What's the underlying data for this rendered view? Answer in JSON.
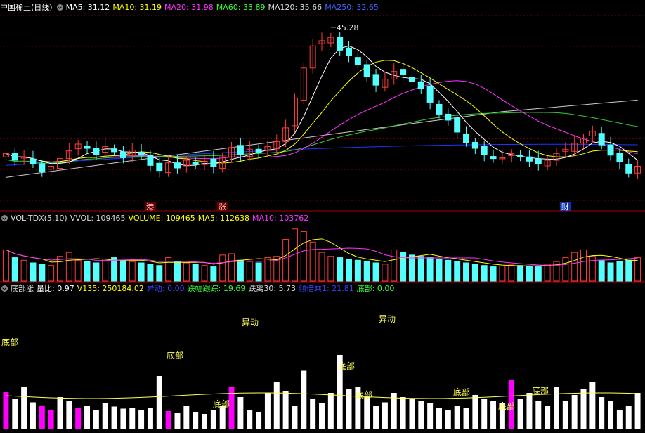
{
  "colors": {
    "up": "#ff3b3b",
    "down": "#54ffff",
    "ma5": "#ffffff",
    "ma10": "#ffff00",
    "ma20": "#ff33ff",
    "ma60": "#33cc33",
    "ma120": "#cccccc",
    "ma250": "#2233ff",
    "grid": "#7a0000",
    "magenta": "#ff00ff",
    "label": "#ffff55"
  },
  "main": {
    "stock": "中国稀土(日线)",
    "ma5": "MA5: 31.12",
    "ma10": "MA10: 31.19",
    "ma20": "MA20: 31.98",
    "ma60": "MA60: 33.89",
    "ma120": "MA120: 35.66",
    "ma250": "MA250: 32.65",
    "peak_label": "45.28",
    "markers": [
      "港",
      "涨",
      "财"
    ]
  },
  "vol": {
    "name": "VOL-TDX(5,10)",
    "vvol": "VVOL: 109465",
    "volume": "VOLUME: 109465",
    "ma5": "MA5: 112638",
    "ma10": "MA10: 103762"
  },
  "ind": {
    "name": "底部涨",
    "liangbi": "量比: 0.97",
    "v135": "V135: 250184.02",
    "yidong": "异动: 0.00",
    "diefu": "跌幅跟踪: 19.69",
    "dieli": "跌离30: 5.73",
    "pilei": "倾倍乘1: 21.81",
    "dibu": "底部: 0.00",
    "labels": [
      "底部",
      "底部",
      "底部",
      "异动",
      "底部",
      "底部",
      "异动",
      "底部",
      "底部",
      "底部"
    ]
  },
  "chart_data": {
    "type": "candlestick",
    "series_count": 71,
    "closes": [
      31.0,
      30.2,
      30.6,
      29.8,
      28.9,
      29.5,
      30.4,
      31.3,
      32.1,
      31.6,
      30.9,
      31.8,
      31.2,
      30.5,
      31.4,
      30.8,
      29.6,
      29.0,
      29.9,
      29.3,
      30.2,
      29.7,
      30.1,
      29.5,
      30.6,
      31.7,
      30.9,
      31.5,
      31.1,
      31.8,
      32.4,
      34.0,
      37.5,
      41.0,
      43.6,
      44.2,
      44.6,
      43.1,
      42.5,
      41.4,
      40.0,
      39.0,
      39.7,
      40.6,
      40.2,
      39.4,
      38.6,
      37.0,
      35.6,
      34.9,
      33.5,
      32.3,
      31.6,
      30.9,
      30.4,
      30.5,
      31.0,
      30.6,
      30.1,
      29.8,
      30.2,
      31.0,
      31.5,
      32.2,
      32.8,
      33.6,
      32.0,
      30.8,
      30.0,
      28.7,
      29.5
    ],
    "volumes": [
      120,
      90,
      80,
      70,
      65,
      60,
      95,
      110,
      80,
      75,
      70,
      85,
      90,
      80,
      75,
      70,
      65,
      60,
      90,
      75,
      70,
      65,
      60,
      55,
      100,
      105,
      80,
      75,
      70,
      90,
      95,
      160,
      200,
      190,
      150,
      110,
      95,
      90,
      85,
      80,
      75,
      70,
      65,
      120,
      110,
      100,
      95,
      90,
      85,
      80,
      75,
      70,
      65,
      60,
      55,
      58,
      62,
      60,
      58,
      55,
      65,
      75,
      90,
      110,
      120,
      95,
      80,
      70,
      75,
      80,
      90
    ],
    "indicator_bars": [
      35,
      28,
      40,
      25,
      22,
      18,
      30,
      26,
      20,
      22,
      18,
      24,
      21,
      19,
      20,
      18,
      20,
      50,
      17,
      15,
      22,
      16,
      14,
      18,
      22,
      40,
      30,
      18,
      16,
      34,
      44,
      36,
      22,
      55,
      28,
      24,
      34,
      70,
      38,
      40,
      30,
      22,
      25,
      34,
      30,
      28,
      26,
      24,
      20,
      18,
      22,
      20,
      32,
      28,
      26,
      24,
      46,
      28,
      34,
      26,
      22,
      40,
      26,
      32,
      38,
      44,
      30,
      26,
      18,
      22,
      34
    ]
  }
}
